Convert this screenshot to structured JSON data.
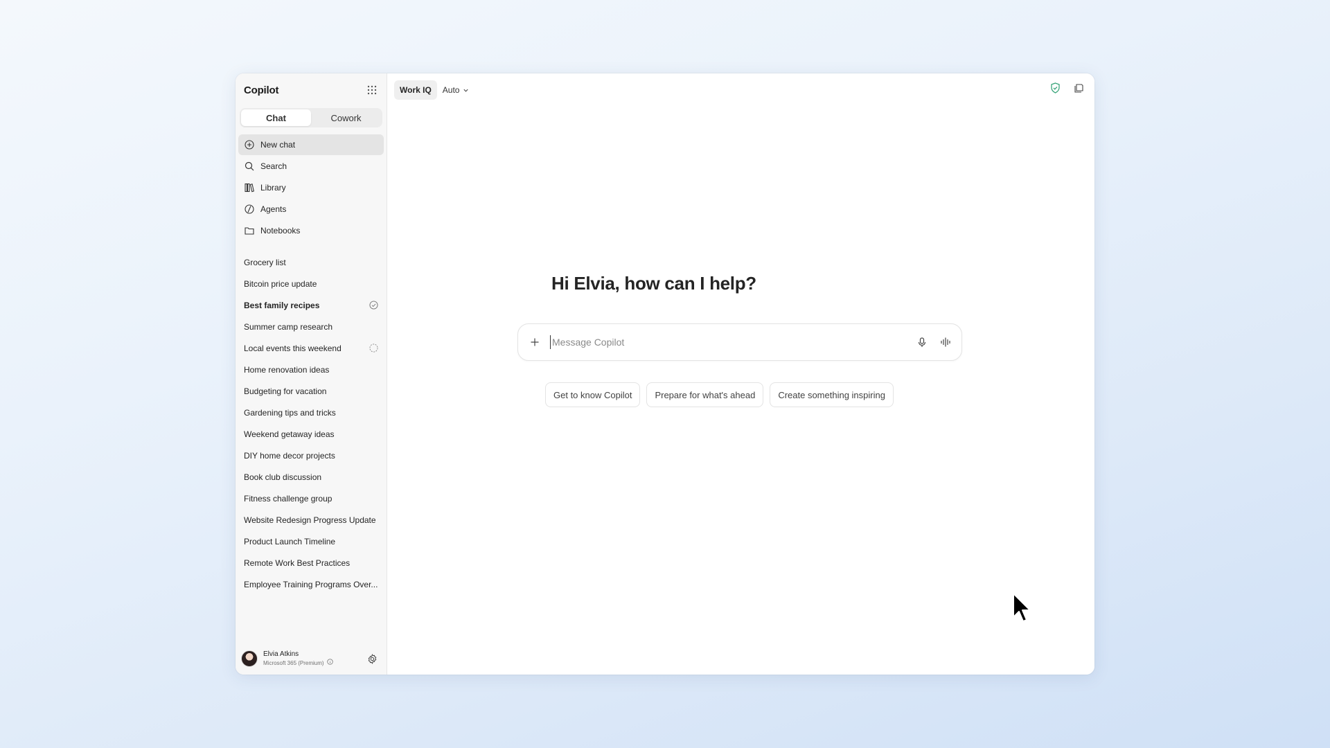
{
  "sidebar": {
    "brand": "Copilot",
    "modes": [
      {
        "label": "Chat",
        "active": true
      },
      {
        "label": "Cowork",
        "active": false
      }
    ],
    "nav": [
      {
        "label": "New chat",
        "icon": "plus-circle-icon"
      },
      {
        "label": "Search",
        "icon": "search-icon"
      },
      {
        "label": "Library",
        "icon": "library-icon"
      },
      {
        "label": "Agents",
        "icon": "agents-icon"
      },
      {
        "label": "Notebooks",
        "icon": "folder-icon"
      }
    ],
    "history": [
      {
        "label": "Grocery list"
      },
      {
        "label": "Bitcoin price update"
      },
      {
        "label": "Best family recipes",
        "status": "check-circle-icon"
      },
      {
        "label": "Summer camp research"
      },
      {
        "label": "Local events this weekend",
        "status": "loading-circle-icon"
      },
      {
        "label": "Home renovation ideas"
      },
      {
        "label": "Budgeting for vacation"
      },
      {
        "label": "Gardening tips and tricks"
      },
      {
        "label": "Weekend getaway ideas"
      },
      {
        "label": "DIY home decor projects"
      },
      {
        "label": "Book club discussion"
      },
      {
        "label": "Fitness challenge group"
      },
      {
        "label": "Website Redesign Progress Update"
      },
      {
        "label": "Product Launch Timeline"
      },
      {
        "label": "Remote Work Best Practices"
      },
      {
        "label": "Employee Training Programs Over..."
      }
    ],
    "user": {
      "name": "Elvia Atkins",
      "plan": "Microsoft 365 (Premium)"
    }
  },
  "topbar": {
    "work_iq": "Work IQ",
    "model": "Auto"
  },
  "main": {
    "greeting": "Hi Elvia, how can I help?",
    "composer": {
      "placeholder": "Message Copilot",
      "value": ""
    },
    "suggestions": [
      {
        "label": "Get to know Copilot"
      },
      {
        "label": "Prepare for what's ahead"
      },
      {
        "label": "Create something inspiring"
      }
    ]
  },
  "colors": {
    "accent_shield": "#3aa57a",
    "sidebar_bg": "#f7f7f7",
    "selected_bg": "#e4e4e4"
  }
}
